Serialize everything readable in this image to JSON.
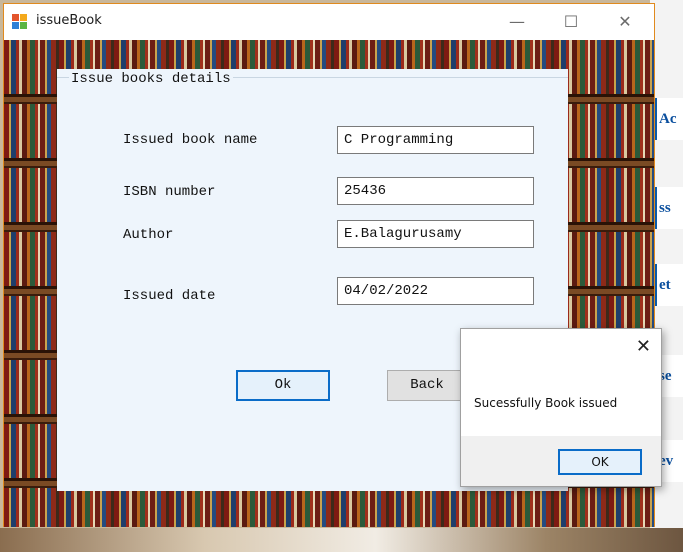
{
  "window": {
    "title": "issueBook",
    "controls": {
      "minimize": "—",
      "maximize": "☐",
      "close": "✕"
    }
  },
  "form": {
    "group_title": "Issue books details",
    "fields": [
      {
        "label": "Issued book name",
        "value": "C Programming"
      },
      {
        "label": "ISBN number",
        "value": "25436"
      },
      {
        "label": "Author",
        "value": "E.Balagurusamy"
      },
      {
        "label": "Issued date",
        "value": "04/02/2022"
      }
    ],
    "buttons": {
      "ok": "Ok",
      "back": "Back"
    }
  },
  "dialog": {
    "message": "Sucessfully Book issued",
    "ok": "OK",
    "close": "✕"
  },
  "background_app": {
    "fragments": [
      "Ac",
      "ss",
      "et",
      "se",
      "ev"
    ]
  },
  "colors": {
    "window_border": "#e08a1e",
    "panel_bg": "#eef5fc",
    "focus_blue": "#0a6cc8",
    "bg_app_text": "#0a4f9e"
  }
}
